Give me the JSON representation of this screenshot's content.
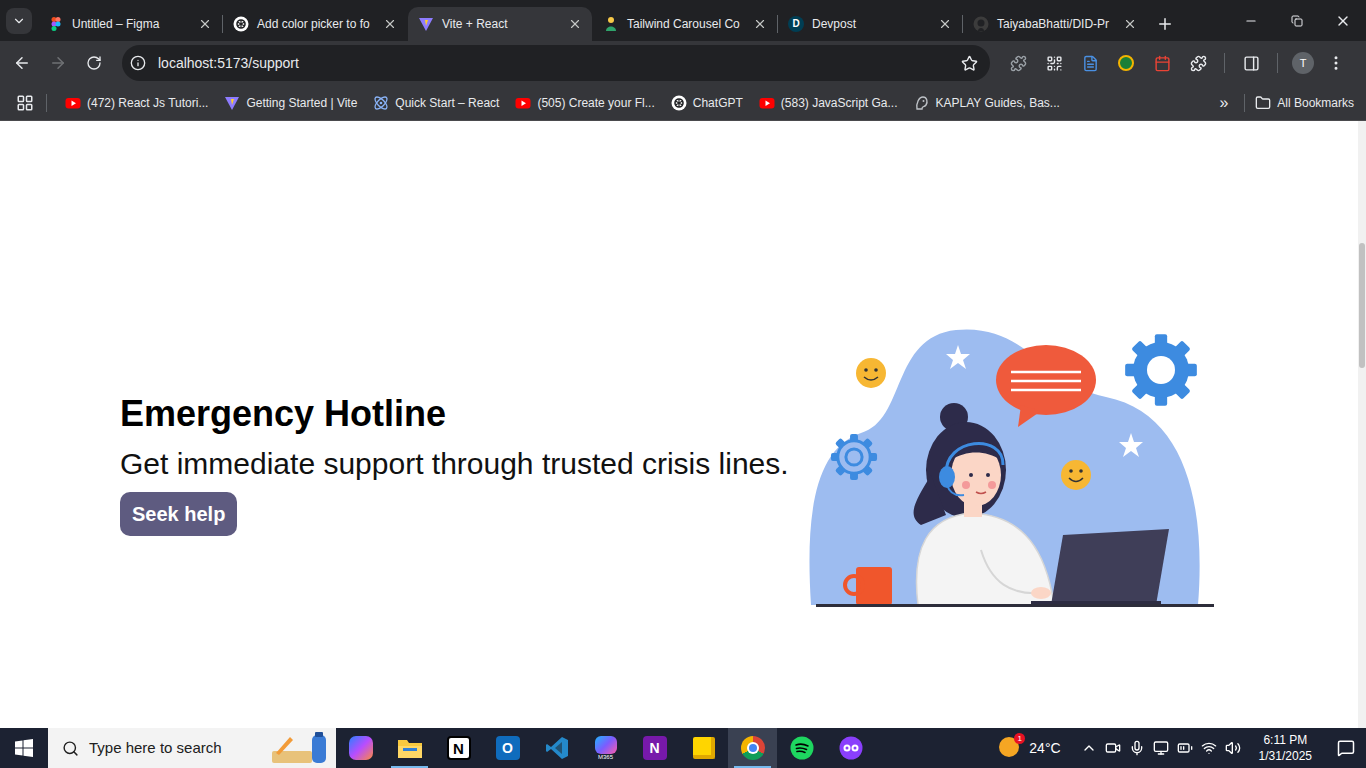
{
  "browser": {
    "tabs": [
      {
        "title": "Untitled – Figma",
        "kind": "figma",
        "selected": false
      },
      {
        "title": "Add color picker to fo",
        "kind": "chatgpt",
        "selected": false
      },
      {
        "title": "Vite + React",
        "kind": "vite",
        "selected": true
      },
      {
        "title": "Tailwind Carousel Co",
        "kind": "tailwind",
        "selected": false
      },
      {
        "title": "Devpost",
        "kind": "devpost",
        "favicon_text": "D",
        "selected": false
      },
      {
        "title": "TaiyabaBhatti/DID-Pr",
        "kind": "github",
        "selected": false
      }
    ],
    "address": "localhost:5173/support",
    "profile_initial": "T",
    "bookmarks": [
      {
        "label": "(472) React Js Tutori...",
        "kind": "youtube"
      },
      {
        "label": "Getting Started | Vite",
        "kind": "vite"
      },
      {
        "label": "Quick Start – React",
        "kind": "react"
      },
      {
        "label": "(505) Create your Fl...",
        "kind": "youtube"
      },
      {
        "label": "ChatGPT",
        "kind": "chatgpt"
      },
      {
        "label": "(583) JavaScript Ga...",
        "kind": "youtube"
      },
      {
        "label": "KAPLAY Guides, Bas...",
        "kind": "kaplay"
      }
    ],
    "bookmarks_overflow": "»",
    "all_bookmarks": "All Bookmarks"
  },
  "page": {
    "heading": "Emergency Hotline",
    "subtitle": "Get immediate support through trusted crisis lines.",
    "button": "Seek help"
  },
  "taskbar": {
    "search_placeholder": "Type here to search",
    "apps": [
      {
        "kind": "copilot",
        "running": false,
        "selected": false
      },
      {
        "kind": "explorer",
        "running": true,
        "selected": false
      },
      {
        "kind": "notion",
        "glyph": "N",
        "running": false,
        "selected": false
      },
      {
        "kind": "outlook",
        "glyph": "O",
        "running": false,
        "selected": false
      },
      {
        "kind": "vscode",
        "running": false,
        "selected": false
      },
      {
        "kind": "m365",
        "glyph": "M365",
        "running": false,
        "selected": false
      },
      {
        "kind": "onenote",
        "glyph": "N",
        "running": false,
        "selected": false
      },
      {
        "kind": "sticky",
        "running": false,
        "selected": false
      },
      {
        "kind": "chrome",
        "running": true,
        "selected": true
      },
      {
        "kind": "spotify",
        "running": false,
        "selected": false
      },
      {
        "kind": "other",
        "running": false,
        "selected": false
      }
    ],
    "weather": {
      "temperature": "24°C",
      "badge": "1"
    },
    "time": "6:11 PM",
    "date": "1/31/2025"
  }
}
